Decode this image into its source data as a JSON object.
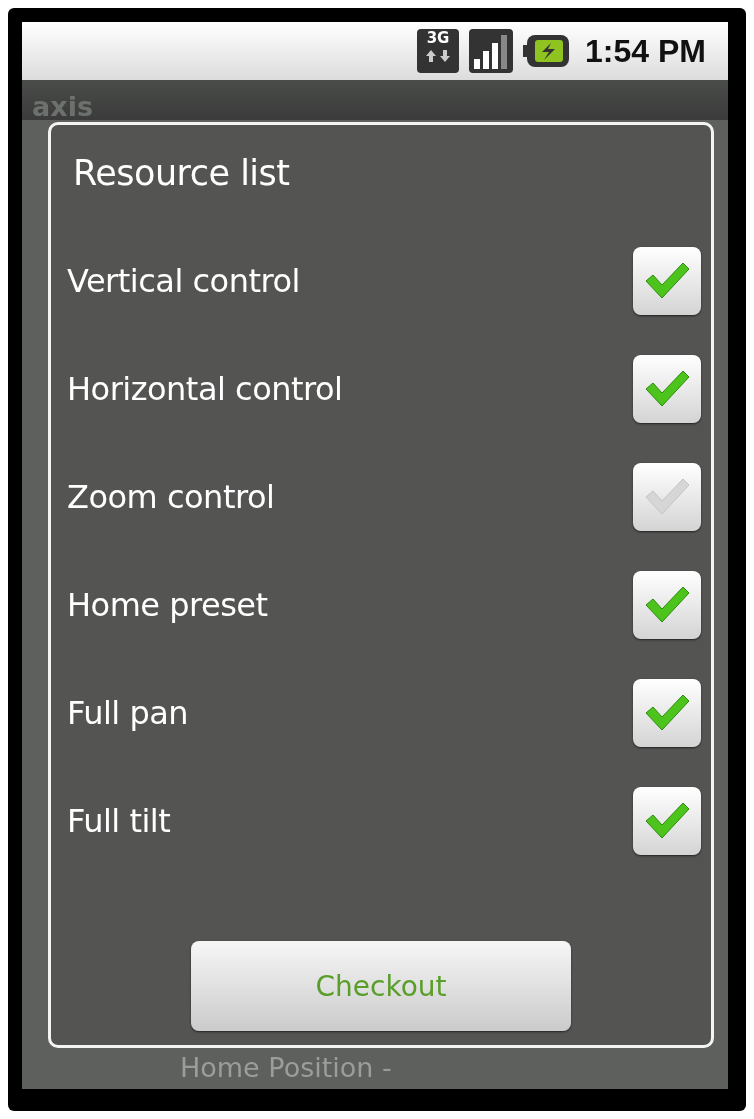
{
  "status_bar": {
    "network_type": "3G",
    "time": "1:54 PM"
  },
  "app": {
    "title": "axis",
    "footer_text": "Home Position -"
  },
  "dialog": {
    "title": "Resource list",
    "items": [
      {
        "label": "Vertical control",
        "checked": true
      },
      {
        "label": "Horizontal control",
        "checked": true
      },
      {
        "label": "Zoom control",
        "checked": false
      },
      {
        "label": "Home preset",
        "checked": true
      },
      {
        "label": "Full pan",
        "checked": true
      },
      {
        "label": "Full tilt",
        "checked": true
      }
    ],
    "button": "Checkout"
  }
}
